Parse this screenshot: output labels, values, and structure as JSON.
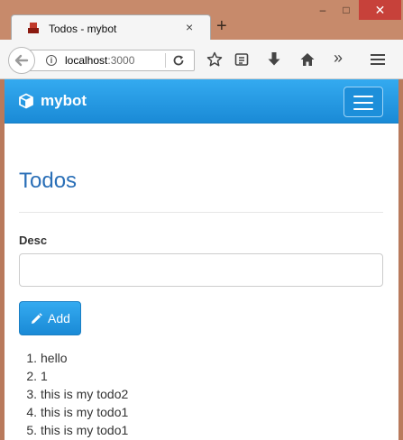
{
  "browser": {
    "tab_title": "Todos - mybot",
    "tab_close": "×",
    "new_tab": "+",
    "window_buttons": {
      "minimize": "–",
      "maximize": "□",
      "close": "✕"
    },
    "url_host": "localhost",
    "url_port": ":3000",
    "overflow": "»",
    "icons": [
      "back-arrow-icon",
      "info-icon",
      "reload-icon",
      "star-icon",
      "reader-list-icon",
      "download-icon",
      "home-icon",
      "overflow-icon",
      "menu-icon"
    ]
  },
  "navbar": {
    "brand": "mybot",
    "brand_icon": "cube-icon",
    "toggle_icon": "hamburger-icon"
  },
  "main": {
    "heading": "Todos",
    "desc_label": "Desc",
    "desc_value": "",
    "add_button_label": "Add",
    "add_button_icon": "pencil-icon",
    "todos": [
      {
        "num": "1.",
        "text": "hello"
      },
      {
        "num": "2.",
        "text": "1"
      },
      {
        "num": "3.",
        "text": "this is my todo2"
      },
      {
        "num": "4.",
        "text": "this is my todo1"
      },
      {
        "num": "5.",
        "text": "this is my todo1"
      }
    ]
  },
  "colors": {
    "accent": "#2196e6",
    "heading": "#2a6fb7",
    "titlebar": "#c78a6b",
    "close_button": "#c7413a"
  }
}
